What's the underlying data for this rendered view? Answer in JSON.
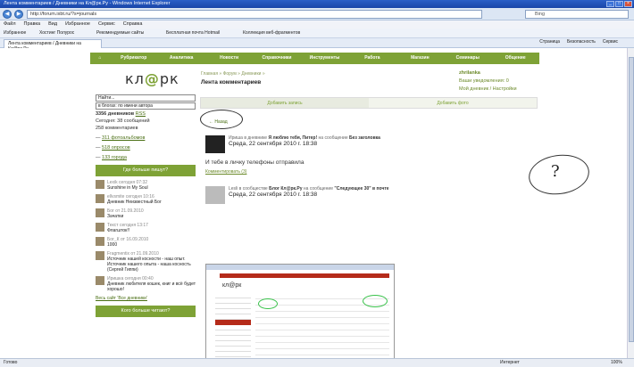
{
  "window": {
    "title": "Лента комментариев / Дневники на Кл@рк.Ру - Windows Internet Explorer",
    "url": "http://forum.ixbt.ru/?s=journals",
    "search_placeholder": "Bing"
  },
  "menu": [
    "Файл",
    "Правка",
    "Вид",
    "Избранное",
    "Сервис",
    "Справка"
  ],
  "favorites": [
    "Избранное",
    "Хостинг Полурос",
    "Рекомендуемые сайты",
    "Бесплатная почта Hotmail",
    "Коллекция веб-фрагментов"
  ],
  "tab": {
    "label": "Лента комментариев / Дневники на Кл@рк.Ру"
  },
  "tools": [
    "Страница",
    "Безопасность",
    "Сервис"
  ],
  "site": {
    "nav": [
      "Рубрикатор",
      "Аналитика",
      "Новости",
      "Справочники",
      "Инструменты",
      "Работа",
      "Магазин",
      "Семинары",
      "Общение"
    ],
    "logo_left": "кл",
    "logo_mark": "@",
    "logo_right": "рк",
    "breadcrumb": "Главная » Форум » Дневники »",
    "title": "Лента комментариев"
  },
  "user": {
    "name": "zhrilanka",
    "line1": "Ваши уведомления: 0",
    "line2": "Мой дневник / Настройки"
  },
  "left": {
    "search_value": "Найти...",
    "search_scope": "в блогах: по имени автора",
    "stats": [
      {
        "text": "3356 дневников",
        "link": "RSS"
      },
      {
        "text": "Сегодня: 38 сообщений"
      },
      {
        "text": "258 комментариев"
      }
    ],
    "links": [
      "311 фотоальбомов",
      "518 опросов",
      "133 города"
    ],
    "box_title": "Где больше пишут?",
    "feed": [
      {
        "meta": "Lexik сегодня 07:32",
        "title": "Sunshine in My Soul"
      },
      {
        "meta": "ellvsmite сегодня 10:16",
        "title": "Дневник Неизвестный Бог"
      },
      {
        "meta": "Бог от 21.09.2010",
        "title": "Зачатки"
      },
      {
        "meta": "Текст сегодня 13:17",
        "title": "Флагшток!!"
      },
      {
        "meta": "Бог_К от 16.09.2010",
        "title": "1000"
      },
      {
        "meta": "Fragmentix от 21.09.2010",
        "title": "Источник нашей косности - наш опыт. Источник нашего опыта - наша косность (Сергей Гиппи)"
      },
      {
        "meta": "Иришка сегодня 00:40",
        "title": "Дневник любителя кошек, книг и всё будет хорошо!"
      }
    ],
    "all_posts": "Весь сайт 'Все дневники'",
    "box2_title": "Кого больше читают?"
  },
  "main": {
    "tab_add_post": "Добавить запись",
    "tab_add_photo": "Добавить фото",
    "back": "← Назад",
    "posts": [
      {
        "header_pre": "Ириша в дневнике",
        "header_bold": "Я люблю тебя, Питер!",
        "header_mid": "на сообщение",
        "header_bold2": "Без заголовка",
        "date": "Среда, 22 сентября 2010 г. 18:38",
        "text": "И тебе в личку телефоны отправила",
        "comments": "Комментировать (3)"
      },
      {
        "header_pre": "Lesli в сообществе",
        "header_bold": "Блог Кл@рк.Ру",
        "header_mid": "на сообщение",
        "header_bold2": "\"Следующее 30\" в почте",
        "date": "Среда, 22 сентября 2010 г. 18:38"
      }
    ]
  },
  "status": {
    "left": "Готово",
    "zone": "Интернет",
    "zoom": "100%"
  },
  "annotation": {
    "mark": "?"
  }
}
